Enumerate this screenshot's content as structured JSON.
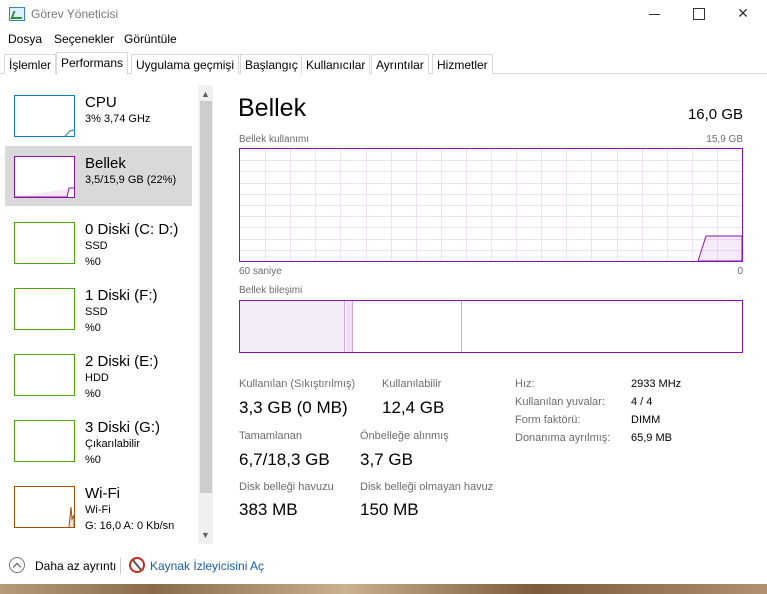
{
  "window": {
    "title": "Görev Yöneticisi"
  },
  "menu": [
    "Dosya",
    "Seçenekler",
    "Görüntüle"
  ],
  "tabs": [
    {
      "label": "İşlemler",
      "active": false
    },
    {
      "label": "Performans",
      "active": true
    },
    {
      "label": "Uygulama geçmişi",
      "active": false
    },
    {
      "label": "Başlangıç",
      "active": false
    },
    {
      "label": "Kullanıcılar",
      "active": false
    },
    {
      "label": "Ayrıntılar",
      "active": false
    },
    {
      "label": "Hizmetler",
      "active": false
    }
  ],
  "sidebar": {
    "items": [
      {
        "title": "CPU",
        "lines": [
          "3%  3,74 GHz"
        ],
        "kind": "cpu",
        "selected": false
      },
      {
        "title": "Bellek",
        "lines": [
          "3,5/15,9 GB (22%)"
        ],
        "kind": "mem",
        "selected": true
      },
      {
        "title": "0 Diski (C: D:)",
        "lines": [
          "SSD",
          "%0"
        ],
        "kind": "disk",
        "selected": false
      },
      {
        "title": "1 Diski (F:)",
        "lines": [
          "SSD",
          "%0"
        ],
        "kind": "disk",
        "selected": false
      },
      {
        "title": "2 Diski (E:)",
        "lines": [
          "HDD",
          "%0"
        ],
        "kind": "disk",
        "selected": false
      },
      {
        "title": "3 Diski (G:)",
        "lines": [
          "Çıkarılabilir",
          "%0"
        ],
        "kind": "disk",
        "selected": false
      },
      {
        "title": "Wi-Fi",
        "lines": [
          "Wi-Fi",
          "G: 16,0  A: 0 Kb/sn"
        ],
        "kind": "wifi",
        "selected": false
      }
    ]
  },
  "main": {
    "title": "Bellek",
    "total": "16,0 GB",
    "usage_label": "Bellek kullanımı",
    "usage_max": "15,9 GB",
    "time_left": "60 saniye",
    "time_right": "0",
    "composition_label": "Bellek bileşimi",
    "stats": {
      "in_use_label": "Kullanılan (Sıkıştırılmış)",
      "in_use_value": "3,3 GB (0 MB)",
      "available_label": "Kullanılabilir",
      "available_value": "12,4 GB",
      "committed_label": "Tamamlanan",
      "committed_value": "6,7/18,3 GB",
      "cached_label": "Önbelleğe alınmış",
      "cached_value": "3,7 GB",
      "paged_label": "Disk belleği havuzu",
      "paged_value": "383 MB",
      "nonpaged_label": "Disk belleği olmayan havuz",
      "nonpaged_value": "150 MB"
    },
    "details": [
      {
        "label": "Hız:",
        "value": "2933 MHz"
      },
      {
        "label": "Kullanılan yuvalar:",
        "value": "4 / 4"
      },
      {
        "label": "Form faktörü:",
        "value": "DIMM"
      },
      {
        "label": "Donanıma ayrılmış:",
        "value": "65,9 MB"
      }
    ]
  },
  "footer": {
    "fewer_details": "Daha az ayrıntı",
    "open_monitor": "Kaynak İzleyicisini Aç"
  },
  "colors": {
    "memory": "#8b12ae",
    "cpu": "#117dbb",
    "disk": "#4da60c",
    "wifi": "#a74f01"
  }
}
